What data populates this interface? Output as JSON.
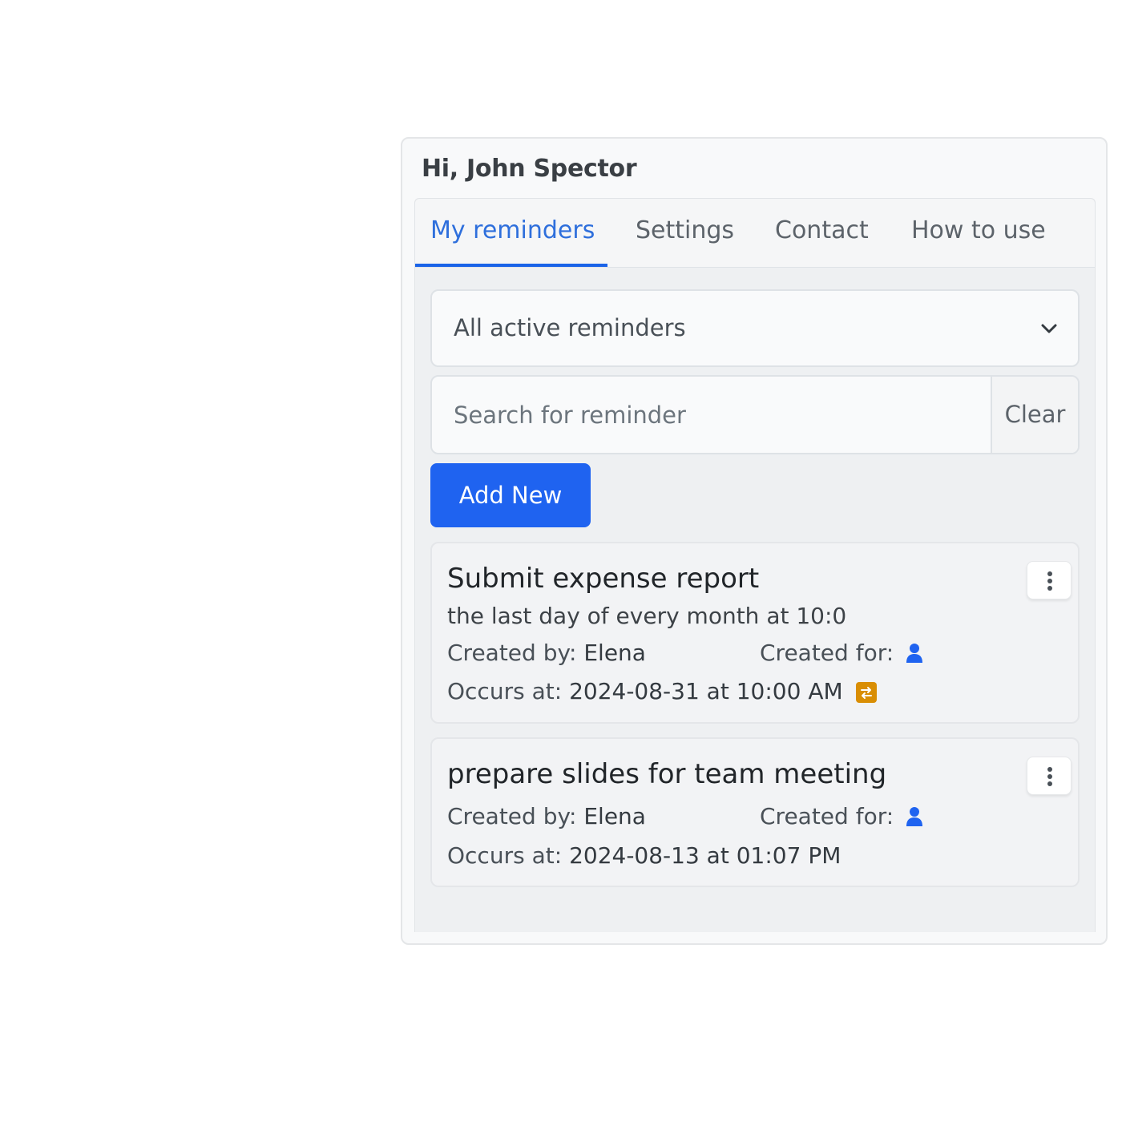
{
  "greeting": "Hi, John Spector",
  "tabs": [
    {
      "label": "My reminders",
      "active": true
    },
    {
      "label": "Settings",
      "active": false
    },
    {
      "label": "Contact",
      "active": false
    },
    {
      "label": "How to use",
      "active": false
    }
  ],
  "filter": {
    "selected": "All active reminders",
    "icon": "chevron-down-icon"
  },
  "search": {
    "placeholder": "Search for reminder",
    "value": "",
    "clear_label": "Clear"
  },
  "add_new_label": "Add New",
  "colors": {
    "accent": "#1f63f0",
    "tab_active": "#2e6fdc",
    "repeat_badge": "#d98e04"
  },
  "reminders": [
    {
      "title": "Submit expense report",
      "recurrence": "the last day of every month at 10:0",
      "created_by_label": "Created by:",
      "created_by": "Elena",
      "created_for_label": "Created for:",
      "created_for_icon": "user-icon",
      "occurs_label": "Occurs at:",
      "occurs_at": "2024-08-31 at 10:00 AM",
      "repeat_icon": "repeat-icon"
    },
    {
      "title": "prepare slides for team meeting",
      "created_by_label": "Created by:",
      "created_by": "Elena",
      "created_for_label": "Created for:",
      "created_for_icon": "user-icon",
      "occurs_label": "Occurs at:",
      "occurs_at": "2024-08-13 at 01:07 PM"
    }
  ]
}
